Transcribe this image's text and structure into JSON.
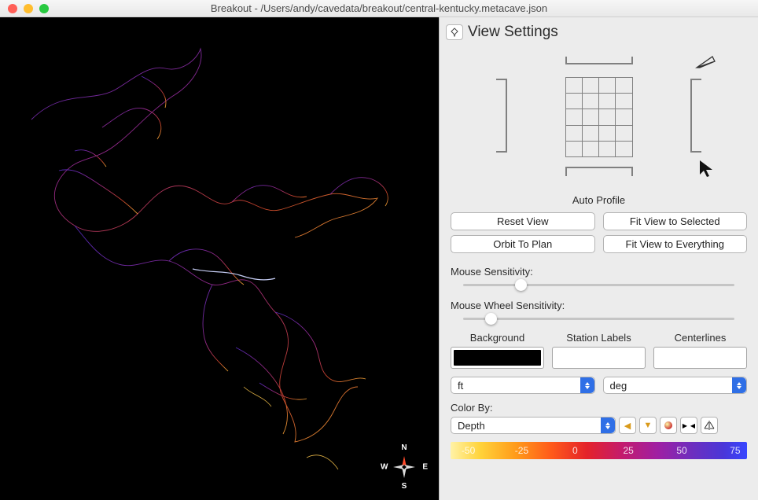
{
  "window": {
    "title": "Breakout - /Users/andy/cavedata/breakout/central-kentucky.metacave.json"
  },
  "compass": {
    "n": "N",
    "s": "S",
    "e": "E",
    "w": "W"
  },
  "panel": {
    "title": "View Settings",
    "auto_profile": "Auto Profile",
    "buttons": {
      "reset_view": "Reset View",
      "fit_selected": "Fit View to Selected",
      "orbit_plan": "Orbit To Plan",
      "fit_everything": "Fit View to Everything"
    },
    "mouse_sensitivity_label": "Mouse Sensitivity:",
    "wheel_sensitivity_label": "Mouse Wheel Sensitivity:",
    "color_cols": {
      "background": "Background",
      "station_labels": "Station Labels",
      "centerlines": "Centerlines"
    },
    "swatches": {
      "background": "#000000",
      "station_labels": "#ffffff",
      "centerlines": "#ffffff"
    },
    "units_select": "ft",
    "angle_select": "deg",
    "color_by_label": "Color By:",
    "color_by_value": "Depth",
    "color_ramp_ticks": [
      "-50",
      "-25",
      "0",
      "25",
      "50",
      "75"
    ],
    "sliders": {
      "mouse_pct": 19,
      "wheel_pct": 8
    },
    "icons": {
      "pin": "pin-icon",
      "persp": "perspective-icon",
      "cursor": "cursor-icon",
      "arrow_left": "flag-left-icon",
      "arrow_down": "flag-down-icon",
      "circle": "circle-icon",
      "swap": "swap-icon",
      "mirror": "mirror-icon"
    }
  }
}
